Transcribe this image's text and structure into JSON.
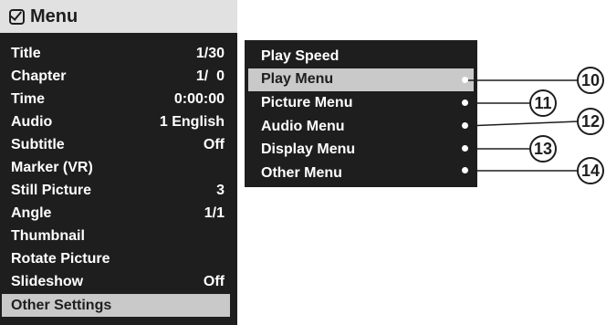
{
  "menu": {
    "title": "Menu",
    "items": [
      {
        "label": "Title",
        "value": "1/30"
      },
      {
        "label": "Chapter",
        "value": "1/  0"
      },
      {
        "label": "Time",
        "value": "0:00:00"
      },
      {
        "label": "Audio",
        "value": "1 English"
      },
      {
        "label": "Subtitle",
        "value": "Off"
      },
      {
        "label": "Marker (VR)",
        "value": ""
      },
      {
        "label": "Still Picture",
        "value": "3"
      },
      {
        "label": "Angle",
        "value": "1/1"
      },
      {
        "label": "Thumbnail",
        "value": ""
      },
      {
        "label": "Rotate Picture",
        "value": ""
      },
      {
        "label": "Slideshow",
        "value": "Off"
      },
      {
        "label": "Other Settings",
        "value": "",
        "selected": true
      }
    ]
  },
  "submenu": {
    "items": [
      {
        "label": "Play Speed"
      },
      {
        "label": "Play Menu",
        "selected": true
      },
      {
        "label": "Picture Menu"
      },
      {
        "label": "Audio Menu"
      },
      {
        "label": "Display Menu"
      },
      {
        "label": "Other Menu"
      }
    ]
  },
  "callouts": [
    "10",
    "11",
    "12",
    "13",
    "14"
  ],
  "icons": {
    "menu_icon": "checkbox-icon"
  },
  "colors": {
    "panel": "#1e1e1e",
    "highlight": "#c9c9c9",
    "header": "#e1e1e1",
    "text": "#ffffff"
  }
}
